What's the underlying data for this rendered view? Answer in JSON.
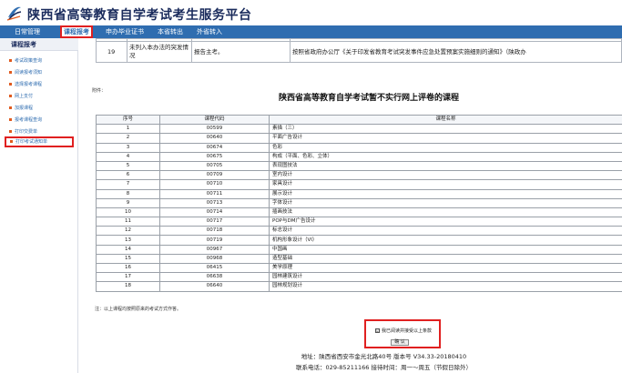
{
  "site": {
    "title": "陕西省高等教育自学考试考生服务平台"
  },
  "nav": {
    "items": [
      {
        "label": "日常管理"
      },
      {
        "label": "课程报考"
      },
      {
        "label": "申办毕业证书"
      },
      {
        "label": "本省转出"
      },
      {
        "label": "外省转入"
      }
    ]
  },
  "sidebar": {
    "title": "课程报考",
    "items": [
      {
        "label": "考试政策查询"
      },
      {
        "label": "阅读报考须知"
      },
      {
        "label": "选择报考课程"
      },
      {
        "label": "网上支付"
      },
      {
        "label": "加报课程"
      },
      {
        "label": "报考课程查询"
      },
      {
        "label": "打印交费单"
      },
      {
        "label": "打印考试通知单"
      }
    ]
  },
  "prev_table": {
    "row_num": "19",
    "col2_line1": "未列入本办法的突发情",
    "col2_line2": "况",
    "col3": "报告主考。",
    "col4": "按照省政府办公厅《关于印发省教育考试突发事件应急处置预案实施细则的通知》（陕政办"
  },
  "fujian_label": "附件：",
  "table_title": "陕西省高等教育自学考试暂不实行网上评卷的课程",
  "course_table": {
    "headers": [
      "序号",
      "课程代码",
      "课程名称"
    ],
    "rows": [
      [
        "1",
        "00599",
        "素描（三）"
      ],
      [
        "2",
        "00640",
        "平面广告设计"
      ],
      [
        "3",
        "00674",
        "色彩"
      ],
      [
        "4",
        "00675",
        "构成（平面、色彩、立体）"
      ],
      [
        "5",
        "00705",
        "表现图技法"
      ],
      [
        "6",
        "00709",
        "室内设计"
      ],
      [
        "7",
        "00710",
        "家具设计"
      ],
      [
        "8",
        "00711",
        "展示设计"
      ],
      [
        "9",
        "00713",
        "字体设计"
      ],
      [
        "10",
        "00714",
        "插画技法"
      ],
      [
        "11",
        "00717",
        "POP与DM广告设计"
      ],
      [
        "12",
        "00718",
        "标志设计"
      ],
      [
        "13",
        "00719",
        "机构形象设计（VI）"
      ],
      [
        "14",
        "00967",
        "中国画"
      ],
      [
        "15",
        "00968",
        "造型基础"
      ],
      [
        "16",
        "06415",
        "美学原理"
      ],
      [
        "17",
        "06638",
        "园林建筑设计"
      ],
      [
        "18",
        "06640",
        "园林规划设计"
      ]
    ]
  },
  "note": "注：以上课程均按照原来的考试方式作答。",
  "agree": {
    "checkbox_mark": "☑",
    "label": "我已阅读并接受以上条款",
    "confirm": "确 认"
  },
  "footer": {
    "line1": "地址：陕西省西安市金光北路40号  版本号 V34.33-20180410",
    "line2": "联系电话：029-85211166  接待时间：周一～周五（节假日除外）"
  }
}
